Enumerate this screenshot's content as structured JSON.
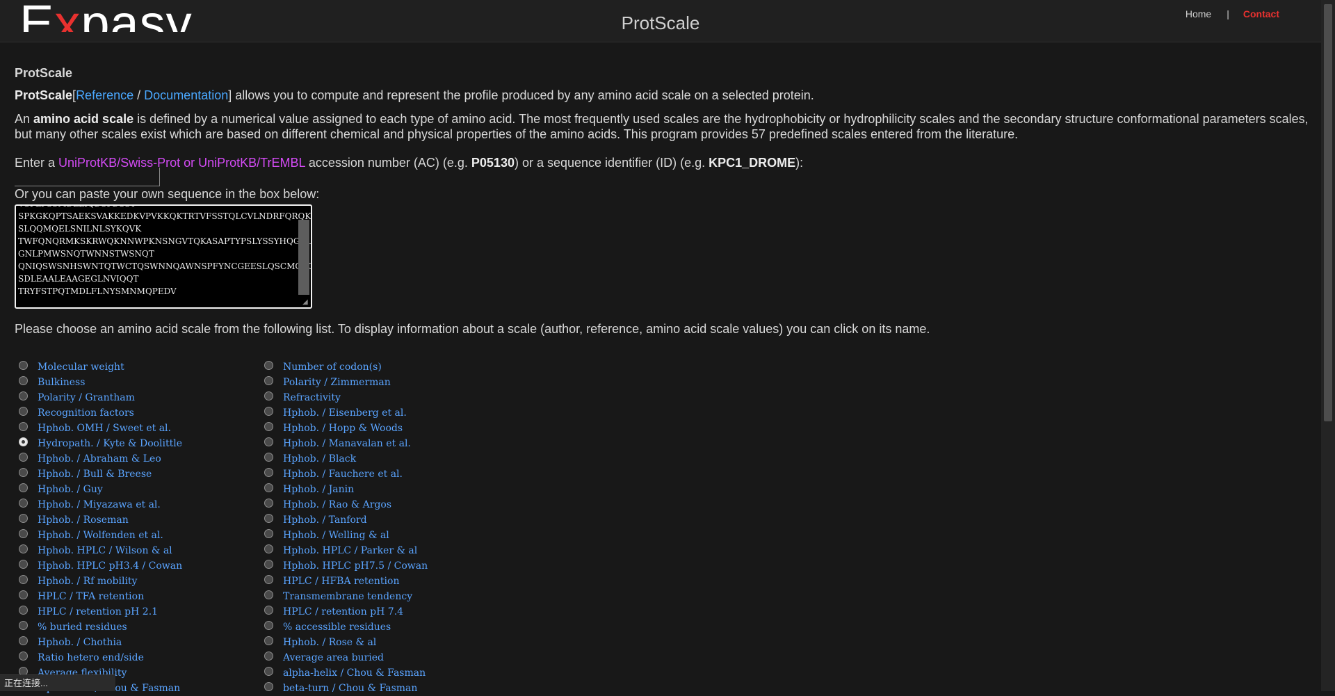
{
  "header": {
    "logo_text": "Expasy",
    "site_title": "ProtScale",
    "nav": {
      "home": "Home",
      "separator": "|",
      "contact": "Contact"
    },
    "colors": {
      "contact": "#e8312f",
      "logo_accent": "#e8312f"
    }
  },
  "intro": {
    "title": "ProtScale",
    "tool_name": "ProtScale",
    "bracket_open": "[",
    "reference": "Reference",
    "slash": "/",
    "documentation": "Documentation",
    "bracket_close": "]",
    "description": " allows you to compute and represent the profile produced by any amino acid scale on a selected protein."
  },
  "scale_def": {
    "lead": "An ",
    "term": "amino acid scale",
    "rest": " is defined by a numerical value assigned to each type of amino acid. The most frequently used scales are the hydrophobicity or hydrophilicity scales and the secondary structure conformational parameters scales, but many other scales exist which are based on different chemical and physical properties of the amino acids. This program provides 57 predefined scales entered from the literature."
  },
  "accession": {
    "enter": "Enter a ",
    "db_link": "UniProtKB/Swiss-Prot or UniProtKB/TrEMBL",
    "mid": " accession number (AC) (e.g. ",
    "ac_example": "P05130",
    "mid2": ") or a sequence identifier (ID) (e.g. ",
    "id_example": "KPC1_DROME",
    "end": "):",
    "value": ""
  },
  "paste": {
    "label": "Or you can paste your own sequence in the box below:",
    "sequence": "VSPLPSSMDLLIQDSPDSST\nSPKGKQPTSAEKSVAKKEDKVPVKKQKTRTVFSSTQLCVLNDRFQRQKYL\nSLQQMQELSNILNLSYKQVK\nTWFQNQRMKSKRWQKNNWPKNSNGVTQKASAPTYPSLYSSYHQGCLVNPT\nGNLPMWSNQTWNNSTWSNQT\nQNIQSWSNHSWNTQTWCTQSWNNQAWNSPFYNCGEESLQSCMQFQPNSPA\nSDLEAALEAAGEGLNVIQQT\nTRYFSTPQTMDLFLNYSMNMQPEDV"
  },
  "choose_text": "Please choose an amino acid scale from the following list. To display information about a scale (author, reference, amino acid scale values) you can click on its name.",
  "scales": {
    "left": [
      {
        "label": "Molecular weight",
        "checked": false
      },
      {
        "label": "Bulkiness",
        "checked": false
      },
      {
        "label": "Polarity / Grantham",
        "checked": false
      },
      {
        "label": "Recognition factors",
        "checked": false
      },
      {
        "label": "Hphob. OMH / Sweet et al.",
        "checked": false
      },
      {
        "label": "Hydropath. / Kyte & Doolittle",
        "checked": true
      },
      {
        "label": "Hphob. / Abraham & Leo",
        "checked": false
      },
      {
        "label": "Hphob. / Bull & Breese",
        "checked": false
      },
      {
        "label": "Hphob. / Guy",
        "checked": false
      },
      {
        "label": "Hphob. / Miyazawa et al.",
        "checked": false
      },
      {
        "label": "Hphob. / Roseman",
        "checked": false
      },
      {
        "label": "Hphob. / Wolfenden et al.",
        "checked": false
      },
      {
        "label": "Hphob. HPLC / Wilson & al",
        "checked": false
      },
      {
        "label": "Hphob. HPLC pH3.4 / Cowan",
        "checked": false
      },
      {
        "label": "Hphob. / Rf mobility",
        "checked": false
      },
      {
        "label": "HPLC / TFA retention",
        "checked": false
      },
      {
        "label": "HPLC / retention pH 2.1",
        "checked": false
      },
      {
        "label": "% buried residues",
        "checked": false
      },
      {
        "label": "Hphob. / Chothia",
        "checked": false
      },
      {
        "label": "Ratio hetero end/side",
        "checked": false
      },
      {
        "label": "Average flexibility",
        "checked": false
      },
      {
        "label": "alpha-helix / Chou & Fasman",
        "checked": false
      }
    ],
    "right": [
      {
        "label": "Number of codon(s)",
        "checked": false
      },
      {
        "label": "Polarity / Zimmerman",
        "checked": false
      },
      {
        "label": "Refractivity",
        "checked": false
      },
      {
        "label": "Hphob. / Eisenberg et al.",
        "checked": false
      },
      {
        "label": "Hphob. / Hopp & Woods",
        "checked": false
      },
      {
        "label": "Hphob. / Manavalan et al.",
        "checked": false
      },
      {
        "label": "Hphob. / Black",
        "checked": false
      },
      {
        "label": "Hphob. / Fauchere et al.",
        "checked": false
      },
      {
        "label": "Hphob. / Janin",
        "checked": false
      },
      {
        "label": "Hphob. / Rao & Argos",
        "checked": false
      },
      {
        "label": "Hphob. / Tanford",
        "checked": false
      },
      {
        "label": "Hphob. / Welling & al",
        "checked": false
      },
      {
        "label": "Hphob. HPLC / Parker & al",
        "checked": false
      },
      {
        "label": "Hphob. HPLC pH7.5 / Cowan",
        "checked": false
      },
      {
        "label": "HPLC / HFBA retention",
        "checked": false
      },
      {
        "label": "Transmembrane tendency",
        "checked": false
      },
      {
        "label": "HPLC / retention pH 7.4",
        "checked": false
      },
      {
        "label": "% accessible residues",
        "checked": false
      },
      {
        "label": "Hphob. / Rose & al",
        "checked": false
      },
      {
        "label": "Average area buried",
        "checked": false
      },
      {
        "label": "alpha-helix / Chou & Fasman",
        "checked": false
      },
      {
        "label": "beta-turn / Chou & Fasman",
        "checked": false
      }
    ]
  },
  "status_bar": "正在连接..."
}
